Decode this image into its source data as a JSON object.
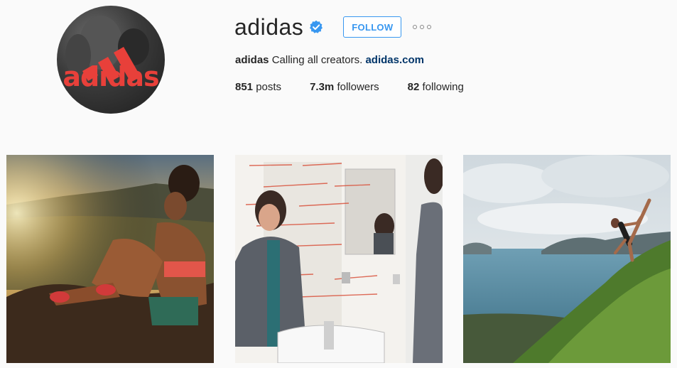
{
  "profile": {
    "username": "adidas",
    "avatar_logo_text": "adidas",
    "follow_label": "FOLLOW",
    "bio_name": "adidas",
    "bio_text": "Calling all creators.",
    "bio_link": "adidas.com",
    "stats": {
      "posts_count": "851",
      "posts_label": "posts",
      "followers_count": "7.3m",
      "followers_label": "followers",
      "following_count": "82",
      "following_label": "following"
    }
  },
  "icons": {
    "verified": "verified-badge-icon",
    "more": "more-options-icon"
  },
  "colors": {
    "accent": "#3897f0",
    "link": "#003569",
    "brand_red": "#e8403a",
    "background": "#fafafa"
  },
  "posts": [
    {
      "description": "sunset-hike-photo"
    },
    {
      "description": "mirror-photo"
    },
    {
      "description": "coastal-yoga-photo"
    }
  ],
  "mirror_text": "WIN THE UNDER-20 WORLD CUP FOR US WOMENS TEAM MAKE THE RIO GOLD IN EVERYTHING"
}
